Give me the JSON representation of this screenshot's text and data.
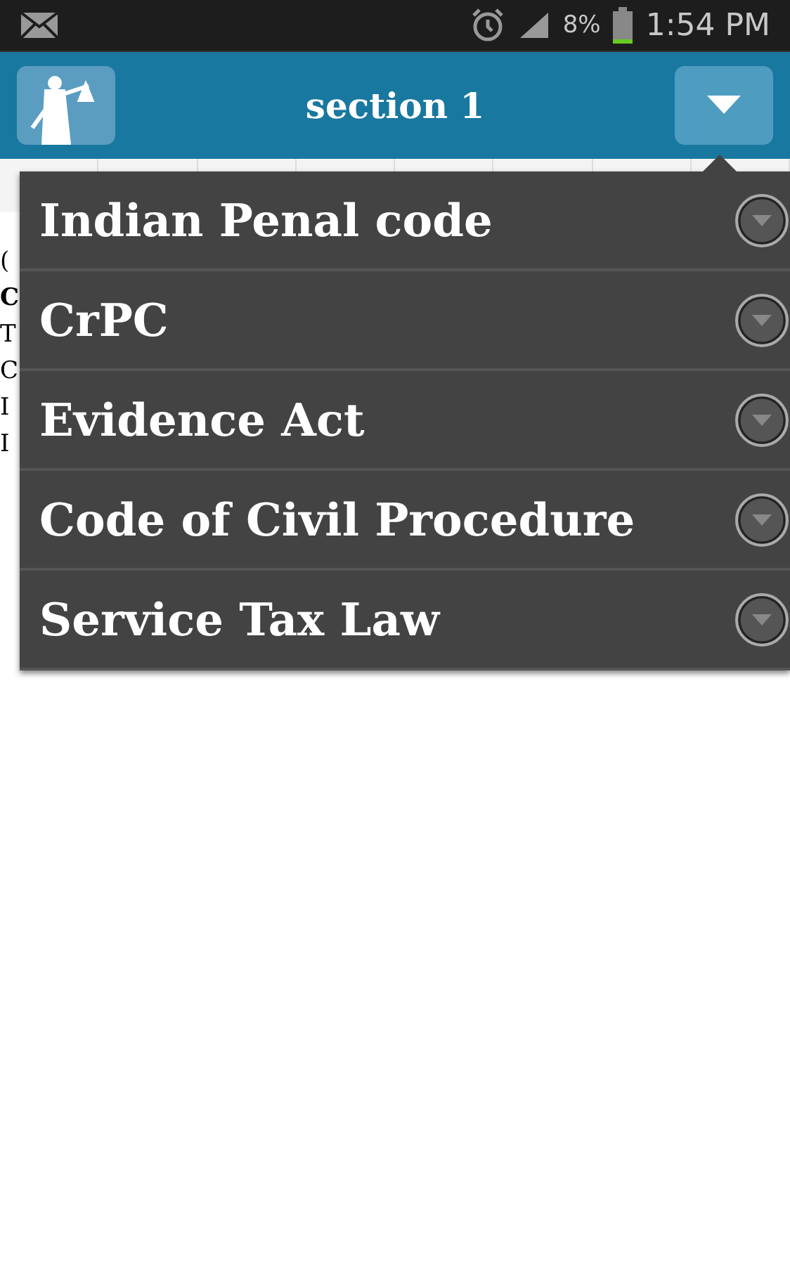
{
  "status_bar": {
    "battery": "8%",
    "time": "1:54 PM"
  },
  "header": {
    "title": "section 1"
  },
  "body_lines": [
    {
      "text": "(",
      "bold": false
    },
    {
      "text": "C",
      "bold": true
    },
    {
      "text": "T",
      "bold": false
    },
    {
      "text": "C",
      "bold": false
    },
    {
      "text": "I",
      "bold": false
    },
    {
      "text": "I",
      "bold": false
    }
  ],
  "menu": {
    "items": [
      {
        "label": "Indian Penal code"
      },
      {
        "label": "CrPC"
      },
      {
        "label": "Evidence Act"
      },
      {
        "label": "Code of Civil Procedure"
      },
      {
        "label": "Service Tax Law"
      }
    ]
  }
}
